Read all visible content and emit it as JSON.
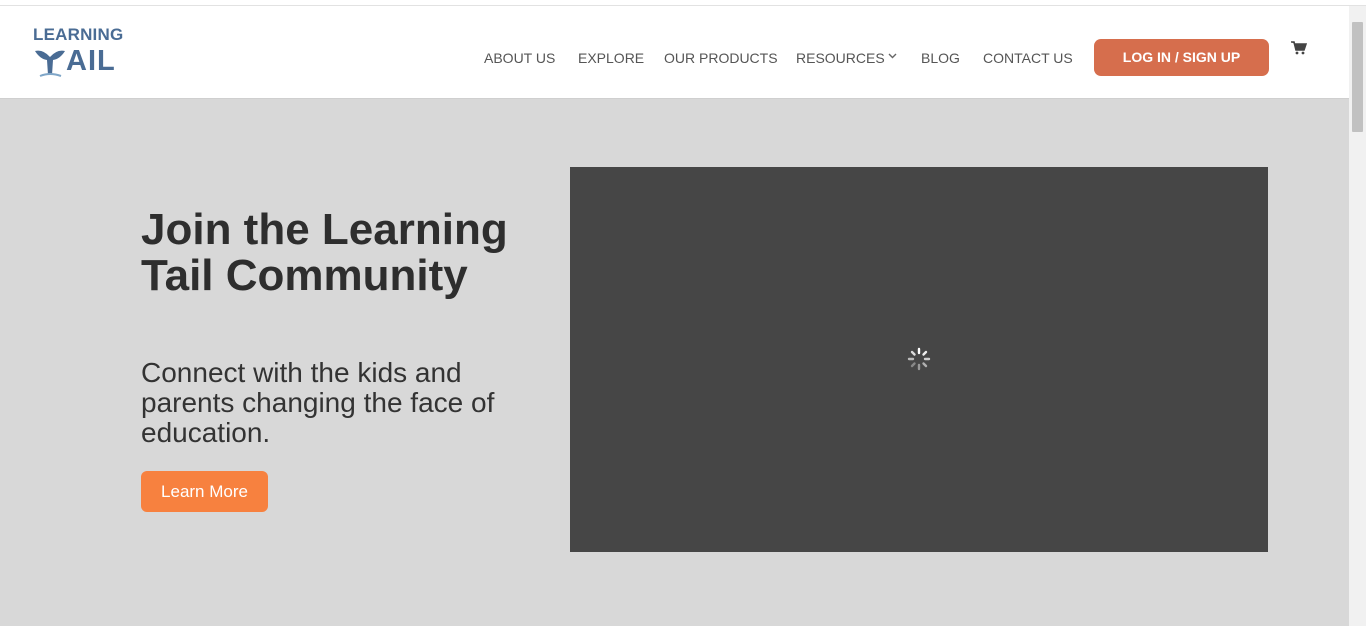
{
  "logo": {
    "top_text": "LEARNING",
    "bottom_text": "AIL",
    "icon": "whale-tail-icon"
  },
  "nav": {
    "items": [
      "ABOUT US",
      "EXPLORE",
      "OUR PRODUCTS",
      "RESOURCES",
      "BLOG",
      "CONTACT US"
    ],
    "resources_icon": "chevron-down-icon",
    "login_label": "LOG IN / SIGN UP",
    "cart_icon": "cart-icon"
  },
  "hero": {
    "title": "Join the Learning Tail Community",
    "subtitle": "Connect with the kids and parents changing the face of education.",
    "button_label": "Learn More"
  },
  "video": {
    "state_icon": "loading-spinner-icon"
  },
  "colors": {
    "brand": "#4a6c94",
    "login_button": "#d66e4d",
    "learn_button": "#f7813f",
    "hero_bg": "#d8d8d8",
    "video_bg": "#464646"
  }
}
